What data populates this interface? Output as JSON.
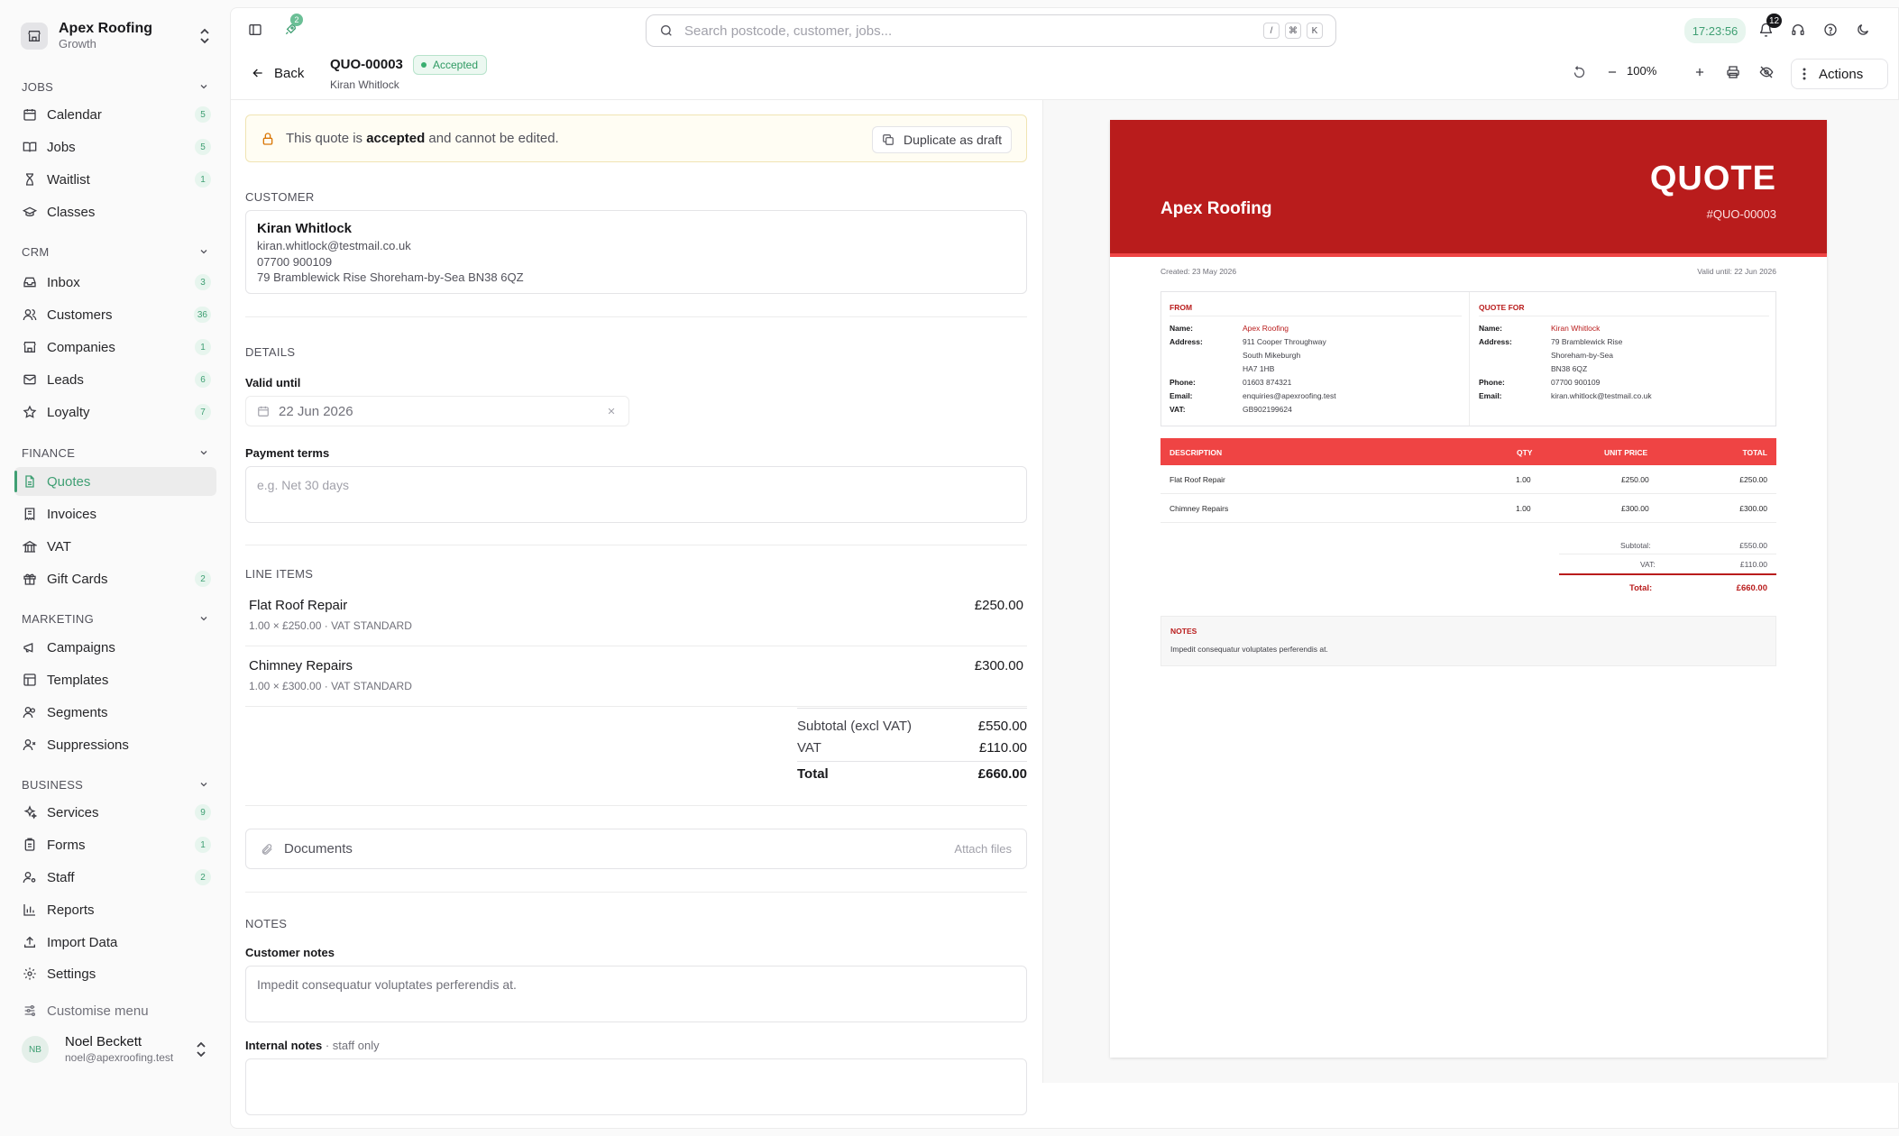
{
  "org": {
    "name": "Apex Roofing",
    "plan": "Growth"
  },
  "nav": {
    "sections": [
      {
        "title": "JOBS",
        "items": [
          {
            "label": "Calendar",
            "badge": "5",
            "icon": "calendar-icon"
          },
          {
            "label": "Jobs",
            "badge": "5",
            "icon": "book-icon"
          },
          {
            "label": "Waitlist",
            "badge": "1",
            "icon": "hourglass-icon"
          },
          {
            "label": "Classes",
            "badge": "",
            "icon": "graduation-cap-icon"
          }
        ]
      },
      {
        "title": "CRM",
        "items": [
          {
            "label": "Inbox",
            "badge": "3",
            "icon": "inbox-icon"
          },
          {
            "label": "Customers",
            "badge": "36",
            "icon": "users-icon"
          },
          {
            "label": "Companies",
            "badge": "1",
            "icon": "store-icon"
          },
          {
            "label": "Leads",
            "badge": "6",
            "icon": "mail-icon"
          },
          {
            "label": "Loyalty",
            "badge": "7",
            "icon": "star-icon"
          }
        ]
      },
      {
        "title": "FINANCE",
        "items": [
          {
            "label": "Quotes",
            "badge": "",
            "icon": "file-icon",
            "active": true
          },
          {
            "label": "Invoices",
            "badge": "",
            "icon": "receipt-icon"
          },
          {
            "label": "VAT",
            "badge": "",
            "icon": "landmark-icon"
          },
          {
            "label": "Gift Cards",
            "badge": "2",
            "icon": "gift-icon"
          }
        ]
      },
      {
        "title": "MARKETING",
        "items": [
          {
            "label": "Campaigns",
            "badge": "",
            "icon": "megaphone-icon"
          },
          {
            "label": "Templates",
            "badge": "",
            "icon": "layout-icon"
          },
          {
            "label": "Segments",
            "badge": "",
            "icon": "user-group-icon"
          },
          {
            "label": "Suppressions",
            "badge": "",
            "icon": "user-x-icon"
          }
        ]
      },
      {
        "title": "BUSINESS",
        "items": [
          {
            "label": "Services",
            "badge": "9",
            "icon": "sparkles-icon"
          },
          {
            "label": "Forms",
            "badge": "1",
            "icon": "clipboard-icon"
          },
          {
            "label": "Staff",
            "badge": "2",
            "icon": "user-cog-icon"
          },
          {
            "label": "Reports",
            "badge": "",
            "icon": "bar-chart-icon"
          },
          {
            "label": "Import Data",
            "badge": "",
            "icon": "upload-icon"
          }
        ]
      }
    ],
    "settings": "Settings",
    "customise": "Customise menu"
  },
  "user": {
    "initials": "NB",
    "name": "Noel Beckett",
    "email": "noel@apexroofing.test"
  },
  "topbar": {
    "search_placeholder": "Search postcode, customer, jobs...",
    "kbd": [
      "/",
      "⌘",
      "K"
    ],
    "clock": "17:23:56",
    "notifications": "12",
    "rocket_badge": "2"
  },
  "header": {
    "back": "Back",
    "quote_number": "QUO-00003",
    "status": "Accepted",
    "customer": "Kiran Whitlock",
    "zoom": "100%",
    "actions": "Actions"
  },
  "banner": {
    "prefix": "This quote is ",
    "bold": "accepted",
    "suffix": " and cannot be edited.",
    "button": "Duplicate as draft"
  },
  "customer": {
    "section": "CUSTOMER",
    "name": "Kiran Whitlock",
    "email": "kiran.whitlock@testmail.co.uk",
    "phone": "07700 900109",
    "address": "79 Bramblewick Rise Shoreham-by-Sea BN38 6QZ"
  },
  "details": {
    "section": "DETAILS",
    "valid_until_label": "Valid until",
    "valid_until": "22 Jun 2026",
    "payment_terms_label": "Payment terms",
    "payment_terms_placeholder": "e.g. Net 30 days"
  },
  "line_items": {
    "section": "LINE ITEMS",
    "items": [
      {
        "name": "Flat Roof Repair",
        "meta": "1.00 × £250.00 · VAT STANDARD",
        "amount": "£250.00"
      },
      {
        "name": "Chimney Repairs",
        "meta": "1.00 × £300.00 · VAT STANDARD",
        "amount": "£300.00"
      }
    ],
    "subtotal_label": "Subtotal (excl VAT)",
    "subtotal": "£550.00",
    "vat_label": "VAT",
    "vat": "£110.00",
    "total_label": "Total",
    "total": "£660.00"
  },
  "documents": {
    "label": "Documents",
    "attach": "Attach files"
  },
  "notes": {
    "section": "NOTES",
    "customer_label": "Customer notes",
    "customer_notes": "Impedit consequatur voluptates perferendis at.",
    "internal_label": "Internal notes",
    "internal_hint": " · staff only"
  },
  "preview": {
    "company": "Apex Roofing",
    "title": "QUOTE",
    "number": "#QUO-00003",
    "created": "Created: 23 May 2026",
    "valid_until": "Valid until: 22 Jun 2026",
    "from_title": "FROM",
    "for_title": "QUOTE FOR",
    "field_labels": {
      "name": "Name:",
      "address": "Address:",
      "phone": "Phone:",
      "email": "Email:",
      "vat": "VAT:"
    },
    "from": {
      "name": "Apex Roofing",
      "address": [
        "911 Cooper Throughway",
        "South Mikeburgh",
        "HA7 1HB"
      ],
      "phone": "01603 874321",
      "email": "enquiries@apexroofing.test",
      "vat": "GB902199624"
    },
    "to": {
      "name": "Kiran Whitlock",
      "address": [
        "79 Bramblewick Rise",
        "Shoreham-by-Sea",
        "BN38 6QZ"
      ],
      "phone": "07700 900109",
      "email": "kiran.whitlock@testmail.co.uk"
    },
    "table_headers": {
      "description": "DESCRIPTION",
      "qty": "QTY",
      "unit_price": "UNIT PRICE",
      "total": "TOTAL"
    },
    "rows": [
      {
        "description": "Flat Roof Repair",
        "qty": "1.00",
        "unit_price": "£250.00",
        "total": "£250.00"
      },
      {
        "description": "Chimney Repairs",
        "qty": "1.00",
        "unit_price": "£300.00",
        "total": "£300.00"
      }
    ],
    "subtotal_label": "Subtotal:",
    "subtotal": "£550.00",
    "vat_label": "VAT:",
    "vat": "£110.00",
    "total_label": "Total:",
    "total": "£660.00",
    "notes_title": "NOTES",
    "notes": "Impedit consequatur voluptates perferendis at."
  },
  "colors": {
    "accent": "#3f9f73",
    "quote_red": "#b91c1c",
    "quote_table_red": "#ef4444",
    "status_green": "#2f9a63"
  }
}
